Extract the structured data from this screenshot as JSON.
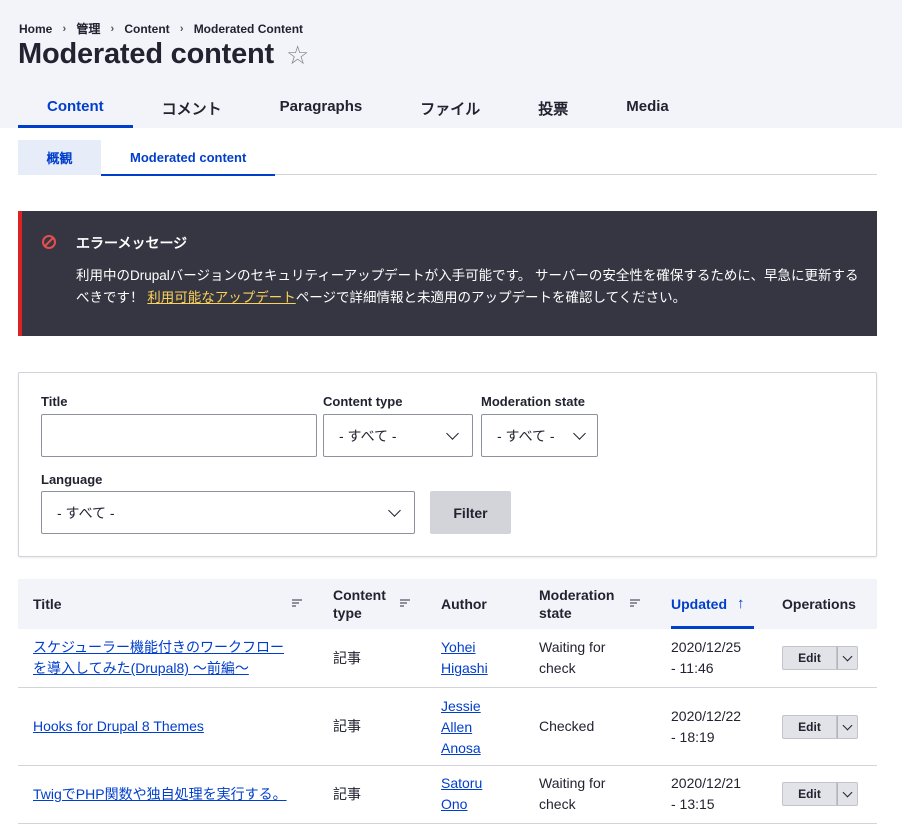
{
  "breadcrumb": [
    "Home",
    "管理",
    "Content",
    "Moderated Content"
  ],
  "page": {
    "title": "Moderated content",
    "star": "☆"
  },
  "primary_tabs": [
    "Content",
    "コメント",
    "Paragraphs",
    "ファイル",
    "投票",
    "Media"
  ],
  "secondary_tabs": [
    "概観",
    "Moderated content"
  ],
  "message": {
    "heading": "エラーメッセージ",
    "body_before": "利用中のDrupalバージョンのセキュリティーアップデートが入手可能です。 サーバーの安全性を確保するために、早急に更新するべきです！ ",
    "link": "利用可能なアップデート",
    "body_after": "ページで詳細情報と未適用のアップデートを確認してください。"
  },
  "filters": {
    "title_label": "Title",
    "title_value": "",
    "content_type_label": "Content type",
    "content_type_value": "- すべて -",
    "moderation_label": "Moderation state",
    "moderation_value": "- すべて -",
    "language_label": "Language",
    "language_value": "- すべて -",
    "filter_button": "Filter"
  },
  "table": {
    "headers": {
      "title": "Title",
      "content_type_1": "Content",
      "content_type_2": "type",
      "author": "Author",
      "moderation_1": "Moderation",
      "moderation_2": "state",
      "updated": "Updated",
      "sort_arrow": "↑",
      "operations": "Operations"
    },
    "edit_label": "Edit",
    "rows": [
      {
        "title_1": "スケジューラー機能付きのワークフロー",
        "title_2": "を導入してみた(Drupal8) ～前編～",
        "type": "記事",
        "author_1": "Yohei",
        "author_2": "Higashi",
        "author_3": "",
        "state_1": "Waiting for",
        "state_2": "check",
        "updated_1": "2020/12/25",
        "updated_2": "- 11:46"
      },
      {
        "title_1": "Hooks for Drupal 8 Themes",
        "title_2": "",
        "type": "記事",
        "author_1": "Jessie",
        "author_2": "Allen",
        "author_3": "Anosa",
        "state_1": "Checked",
        "state_2": "",
        "updated_1": "2020/12/22",
        "updated_2": "- 18:19"
      },
      {
        "title_1": "TwigでPHP関数や独自処理を実行する。",
        "title_2": "",
        "type": "記事",
        "author_1": "Satoru",
        "author_2": "Ono",
        "author_3": "",
        "state_1": "Waiting for",
        "state_2": "check",
        "updated_1": "2020/12/21",
        "updated_2": "- 13:15"
      }
    ]
  }
}
